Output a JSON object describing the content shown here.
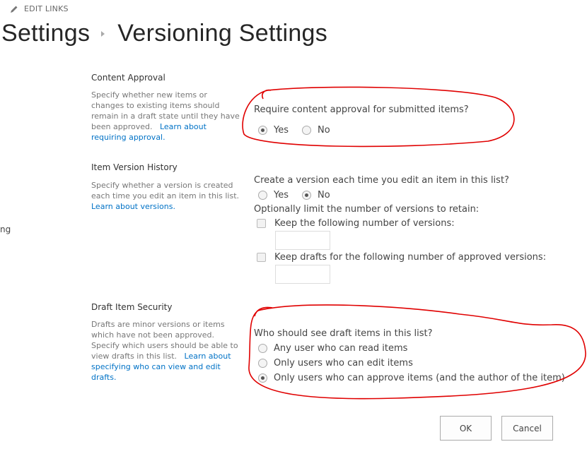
{
  "header": {
    "edit_links": "EDIT LINKS",
    "breadcrumb": [
      "Settings",
      "Versioning Settings"
    ]
  },
  "nav_fragment": "ng",
  "content_approval": {
    "title": "Content Approval",
    "description": "Specify whether new items or changes to existing items should remain in a draft state until they have been approved.",
    "link": "Learn about requiring approval.",
    "question": "Require content approval for submitted items?",
    "options": [
      {
        "label": "Yes",
        "selected": true
      },
      {
        "label": "No",
        "selected": false
      }
    ]
  },
  "version_history": {
    "title": "Item Version History",
    "description": "Specify whether a version is created each time you edit an item in this list.",
    "link": "Learn about versions.",
    "question": "Create a version each time you edit an item in this list?",
    "options": [
      {
        "label": "Yes",
        "selected": false
      },
      {
        "label": "No",
        "selected": true
      }
    ],
    "limit_label": "Optionally limit the number of versions to retain:",
    "keep_versions_label": "Keep the following number of versions:",
    "keep_versions_value": "",
    "keep_drafts_label": "Keep drafts for the following number of approved versions:",
    "keep_drafts_value": ""
  },
  "draft_security": {
    "title": "Draft Item Security",
    "description": "Drafts are minor versions or items which have not been approved. Specify which users should be able to view drafts in this list.",
    "link": "Learn about specifying who can view and edit drafts.",
    "question": "Who should see draft items in this list?",
    "options": [
      {
        "label": "Any user who can read items",
        "selected": false
      },
      {
        "label": "Only users who can edit items",
        "selected": false
      },
      {
        "label": "Only users who can approve items (and the author of the item)",
        "selected": true
      }
    ]
  },
  "buttons": {
    "ok": "OK",
    "cancel": "Cancel"
  },
  "annotation_color": "#e00000"
}
